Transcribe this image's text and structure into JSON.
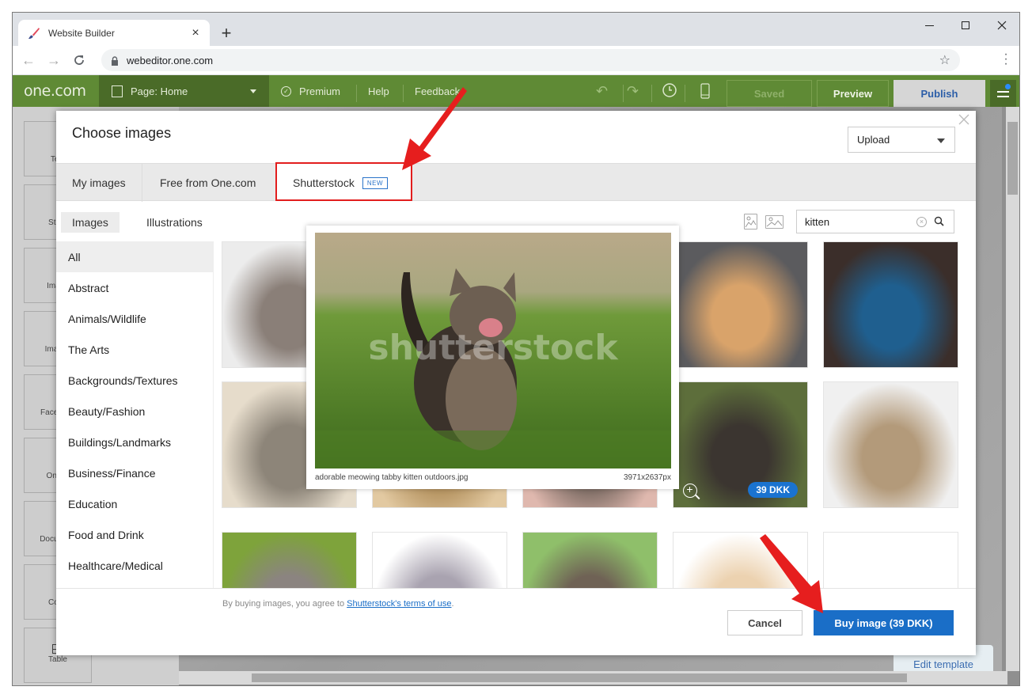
{
  "browser": {
    "tab_title": "Website Builder",
    "url": "webeditor.one.com",
    "new_tab_symbol": "+",
    "tab_close_symbol": "×"
  },
  "app_header": {
    "logo": "one.com",
    "page_selector": "Page: Home",
    "links": [
      "Premium",
      "Help",
      "Feedback"
    ],
    "saved_label": "Saved",
    "preview_label": "Preview",
    "publish_label": "Publish"
  },
  "left_tools": [
    "Text",
    "Store",
    "Image",
    "Images",
    "Facebook",
    "Online",
    "Document",
    "Code",
    "Table"
  ],
  "canvas": {
    "edit_template_label": "Edit template"
  },
  "modal": {
    "title": "Choose images",
    "upload_label": "Upload",
    "source_tabs": [
      {
        "label": "My images",
        "active": false
      },
      {
        "label": "Free from One.com",
        "active": false
      },
      {
        "label": "Shutterstock",
        "active": true,
        "badge": "NEW"
      }
    ],
    "type_tabs": [
      {
        "label": "Images",
        "active": true
      },
      {
        "label": "Illustrations",
        "active": false
      }
    ],
    "search": {
      "value": "kitten",
      "placeholder": ""
    },
    "categories": [
      "All",
      "Abstract",
      "Animals/Wildlife",
      "The Arts",
      "Backgrounds/Textures",
      "Beauty/Fashion",
      "Buildings/Landmarks",
      "Business/Finance",
      "Education",
      "Food and Drink",
      "Healthcare/Medical"
    ],
    "active_category": "All",
    "grid_images": [
      {
        "subject": "grey kitten licking",
        "colors": [
          "#ececec",
          "#8a7f78"
        ]
      },
      {
        "subject": "kitten on table",
        "colors": [
          "#d9d3cc",
          "#a89a8a"
        ]
      },
      {
        "subject": "kitten portrait",
        "colors": [
          "#cfc8bf",
          "#7d6f62"
        ]
      },
      {
        "subject": "kitten sleeping in sweater",
        "colors": [
          "#5b5b5e",
          "#d9a36a"
        ]
      },
      {
        "subject": "calico kitten on blue rug",
        "colors": [
          "#3b2e2a",
          "#1f5f8f"
        ]
      },
      {
        "subject": "two kittens in basket",
        "colors": [
          "#e6dccb",
          "#8d8579"
        ]
      },
      {
        "subject": "kitten on wood floor",
        "colors": [
          "#e2c9a1",
          "#b4925f"
        ]
      },
      {
        "subject": "kitten with bottle",
        "colors": [
          "#dfb8ae",
          "#7d6c64"
        ]
      },
      {
        "subject": "meowing tabby kitten in grass",
        "colors": [
          "#5d6e3b",
          "#3b3530"
        ],
        "selected": true,
        "price": "39 DKK"
      },
      {
        "subject": "three cats peeking",
        "colors": [
          "#f0f0f0",
          "#b39a7a"
        ]
      },
      {
        "subject": "grey kitten in field",
        "colors": [
          "#7ea33b",
          "#8b8480"
        ]
      },
      {
        "subject": "grey kitten peeking",
        "colors": [
          "#ffffff",
          "#a9a3b0"
        ]
      },
      {
        "subject": "kitten with bubbles",
        "colors": [
          "#8fbf6a",
          "#6f6255"
        ]
      },
      {
        "subject": "golden puppy",
        "colors": [
          "#ffffff",
          "#ecd2b0"
        ]
      },
      {
        "subject": "blank",
        "colors": [
          "#ffffff",
          "#ffffff"
        ]
      }
    ],
    "preview": {
      "filename": "adorable meowing tabby kitten outdoors.jpg",
      "dimensions": "3971x2637px",
      "watermark": "shutterstock"
    },
    "footer": {
      "terms_prefix": "By buying images, you agree to ",
      "terms_link": "Shutterstock's terms of use",
      "terms_suffix": ".",
      "cancel_label": "Cancel",
      "buy_label": "Buy image (39 DKK)"
    }
  },
  "colors": {
    "header_green": "#5f8a35",
    "accent_blue": "#1a6ec7",
    "annotation_red": "#e21d1d"
  }
}
